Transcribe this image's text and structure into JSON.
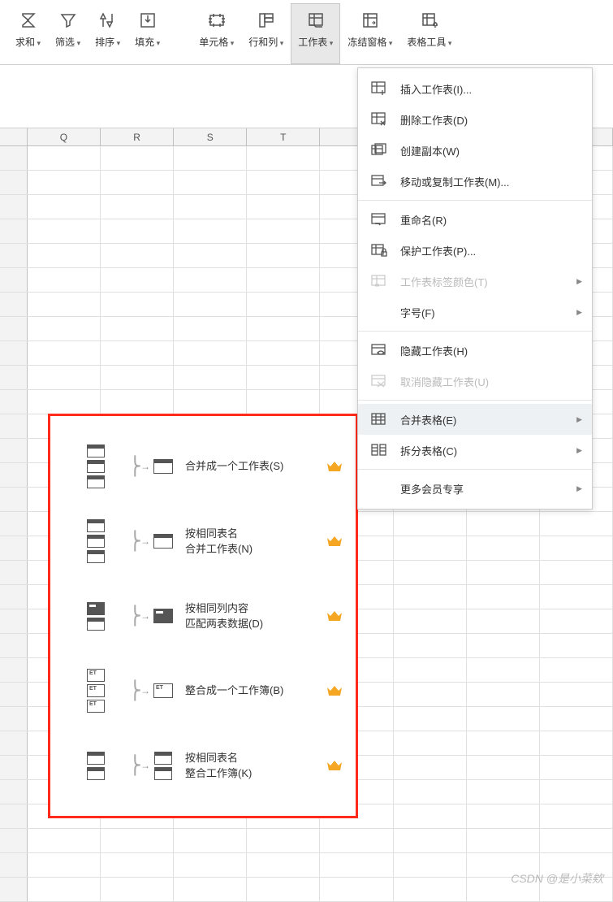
{
  "ribbon": {
    "sum": "求和",
    "filter": "筛选",
    "sort": "排序",
    "fill": "填充",
    "cell": "单元格",
    "rowcol": "行和列",
    "sheet": "工作表",
    "freeze": "冻结窗格",
    "tools": "表格工具"
  },
  "columns": [
    "Q",
    "R",
    "S",
    "T"
  ],
  "menu": {
    "insert": "插入工作表(I)...",
    "delete": "删除工作表(D)",
    "duplicate": "创建副本(W)",
    "move": "移动或复制工作表(M)...",
    "rename": "重命名(R)",
    "protect": "保护工作表(P)...",
    "tabcolor": "工作表标签颜色(T)",
    "fontsize": "字号(F)",
    "hide": "隐藏工作表(H)",
    "unhide": "取消隐藏工作表(U)",
    "merge": "合并表格(E)",
    "split": "拆分表格(C)",
    "morevip": "更多会员专享"
  },
  "submenu": {
    "mergeOne": "合并成一个工作表(S)",
    "mergeByName1": "按相同表名",
    "mergeByName2": "合并工作表(N)",
    "matchCol1": "按相同列内容",
    "matchCol2": "匹配两表数据(D)",
    "mergeBook": "整合成一个工作簿(B)",
    "mergeBookName1": "按相同表名",
    "mergeBookName2": "整合工作簿(K)"
  },
  "watermark": "CSDN @是小菜欸"
}
